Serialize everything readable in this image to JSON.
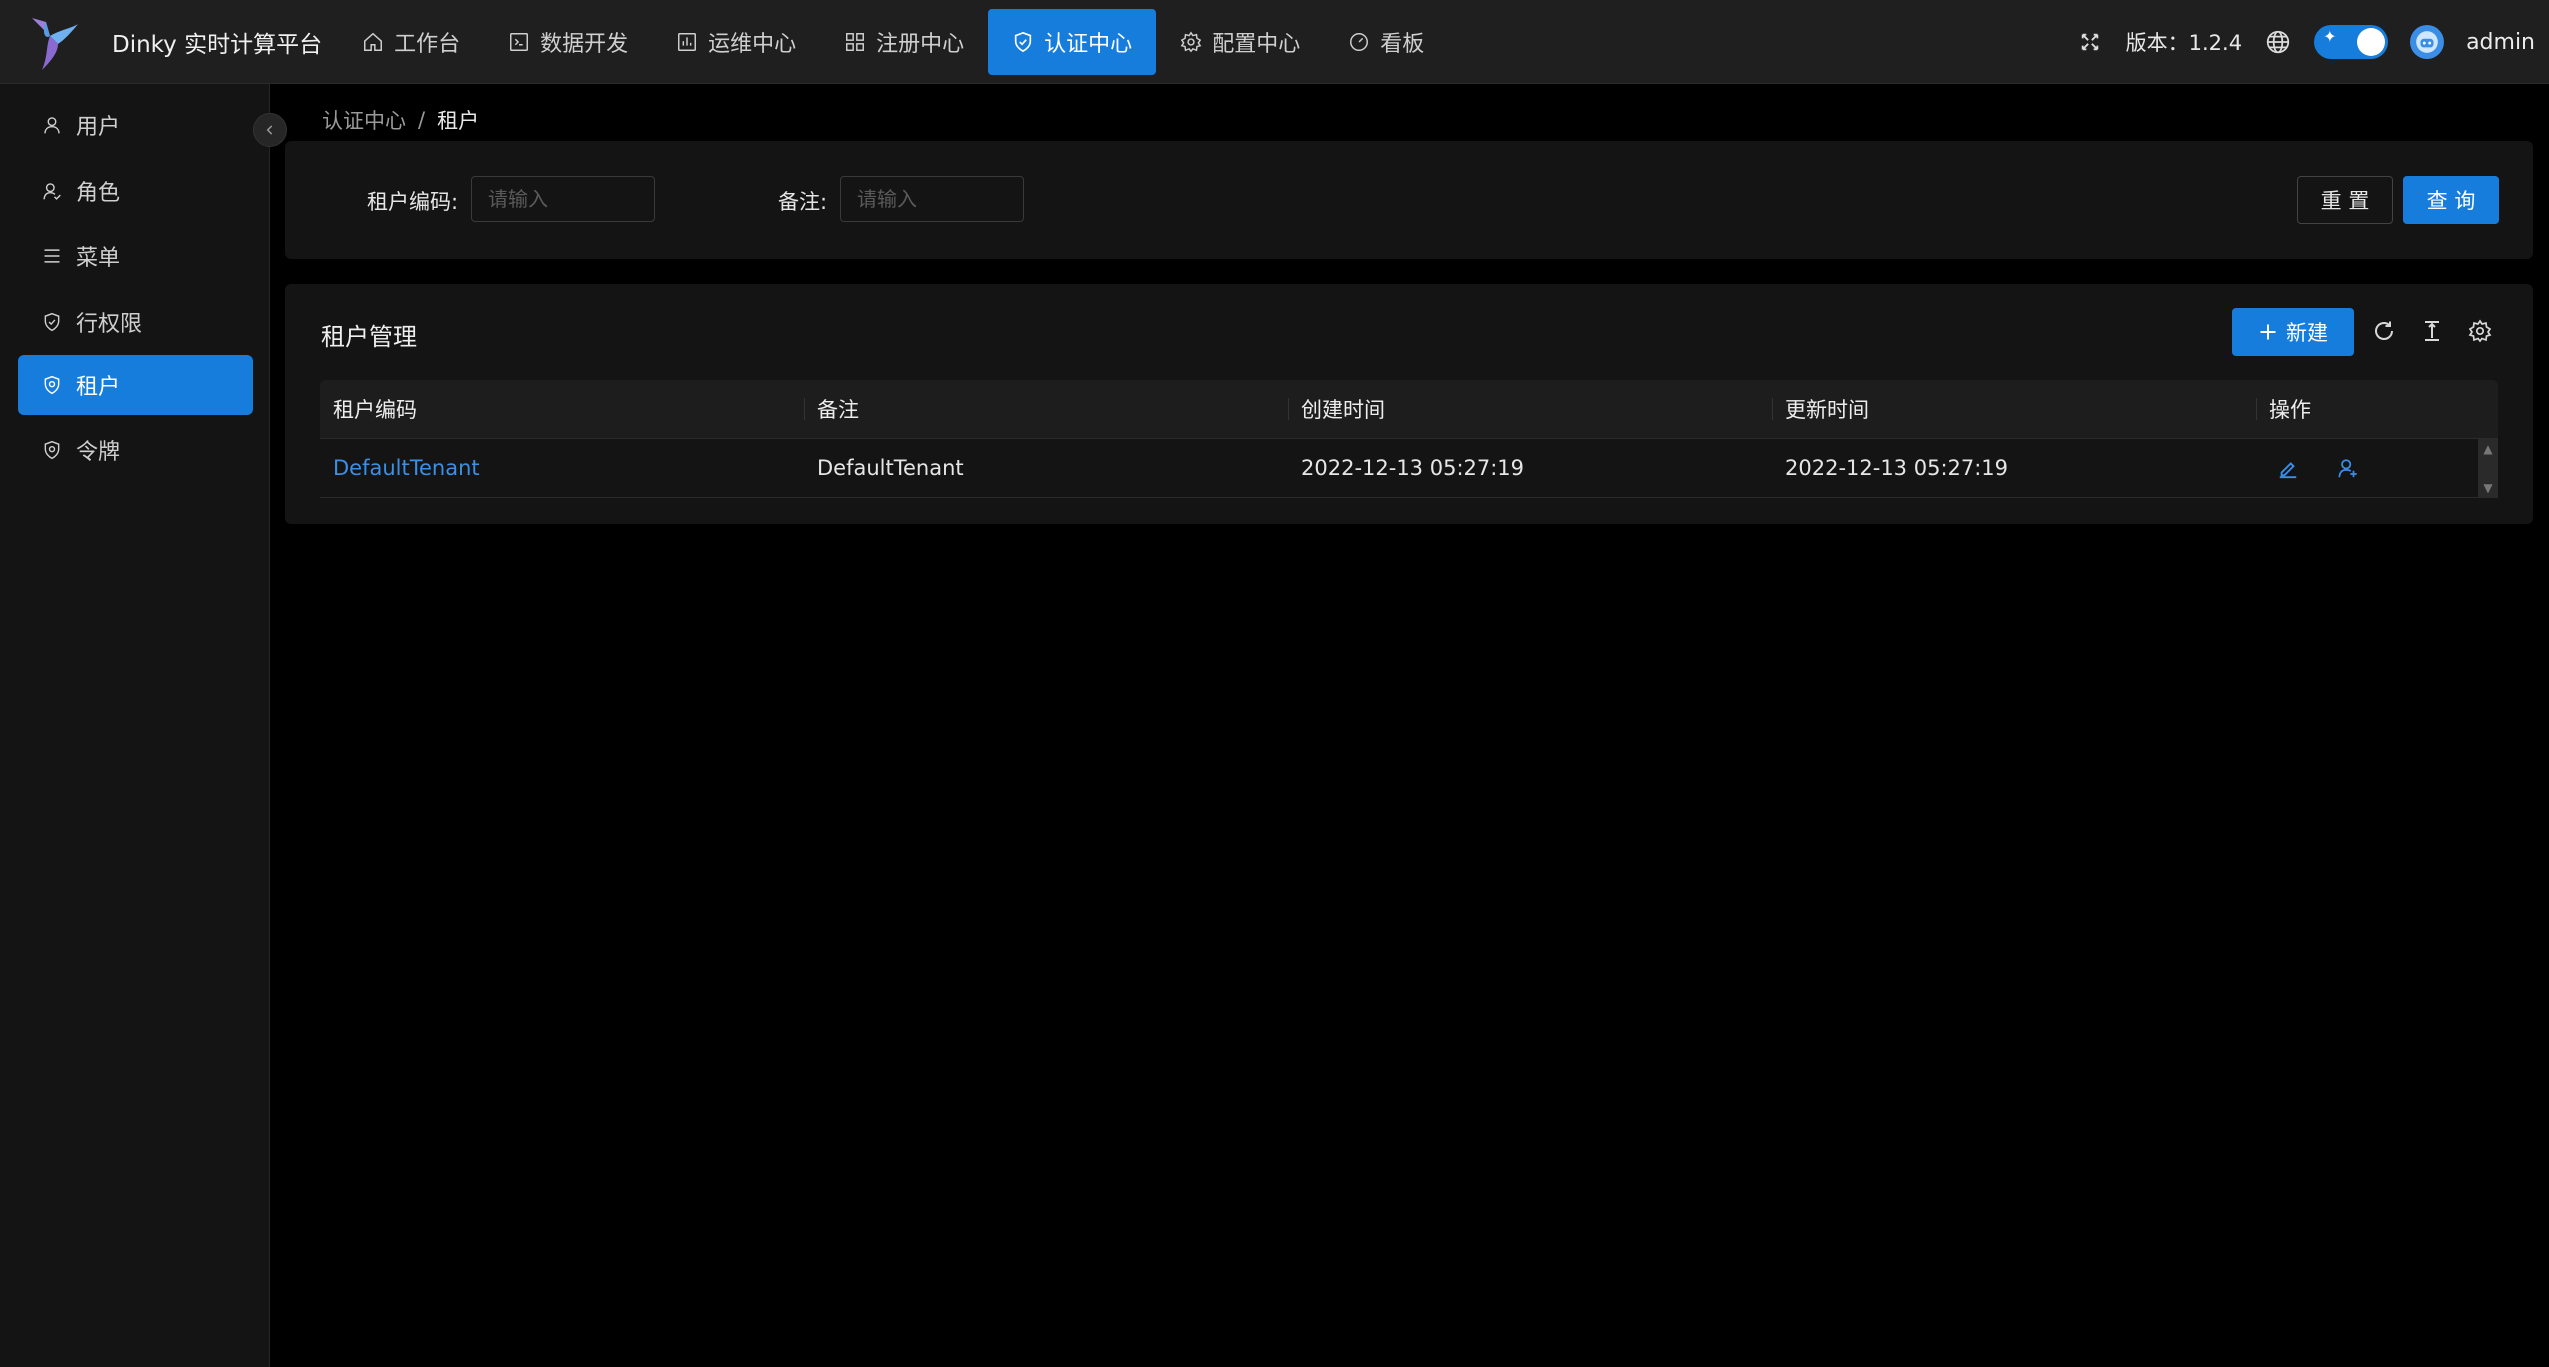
{
  "app": {
    "title": "Dinky 实时计算平台",
    "accent_color": "#177ddc",
    "logo_icon": "hummingbird-logo"
  },
  "nav": {
    "items": [
      {
        "label": "工作台",
        "icon": "home-icon"
      },
      {
        "label": "数据开发",
        "icon": "code-icon"
      },
      {
        "label": "运维中心",
        "icon": "chart-icon"
      },
      {
        "label": "注册中心",
        "icon": "grid-icon"
      },
      {
        "label": "认证中心",
        "icon": "shield-icon",
        "active": true
      },
      {
        "label": "配置中心",
        "icon": "gear-icon"
      },
      {
        "label": "看板",
        "icon": "dashboard-icon"
      }
    ]
  },
  "header_right": {
    "version": "版本：1.2.4",
    "username": "admin",
    "theme_toggle_on": true
  },
  "sidebar": {
    "items": [
      {
        "label": "用户",
        "icon": "user-icon"
      },
      {
        "label": "角色",
        "icon": "role-icon"
      },
      {
        "label": "菜单",
        "icon": "menu-icon"
      },
      {
        "label": "行权限",
        "icon": "shield-icon"
      },
      {
        "label": "租户",
        "icon": "shield-icon",
        "active": true
      },
      {
        "label": "令牌",
        "icon": "shield-icon"
      }
    ]
  },
  "breadcrumb": {
    "parent": "认证中心",
    "separator": "/",
    "current": "租户"
  },
  "search": {
    "tenant_code_label": "租户编码:",
    "tenant_code_placeholder": "请输入",
    "note_label": "备注:",
    "note_placeholder": "请输入",
    "reset_label": "重 置",
    "query_label": "查 询"
  },
  "table": {
    "title": "租户管理",
    "new_label": "新建",
    "columns": [
      "租户编码",
      "备注",
      "创建时间",
      "更新时间",
      "操作"
    ],
    "rows": [
      {
        "tenant_code": "DefaultTenant",
        "note": "DefaultTenant",
        "created": "2022-12-13 05:27:19",
        "updated": "2022-12-13 05:27:19"
      }
    ]
  }
}
